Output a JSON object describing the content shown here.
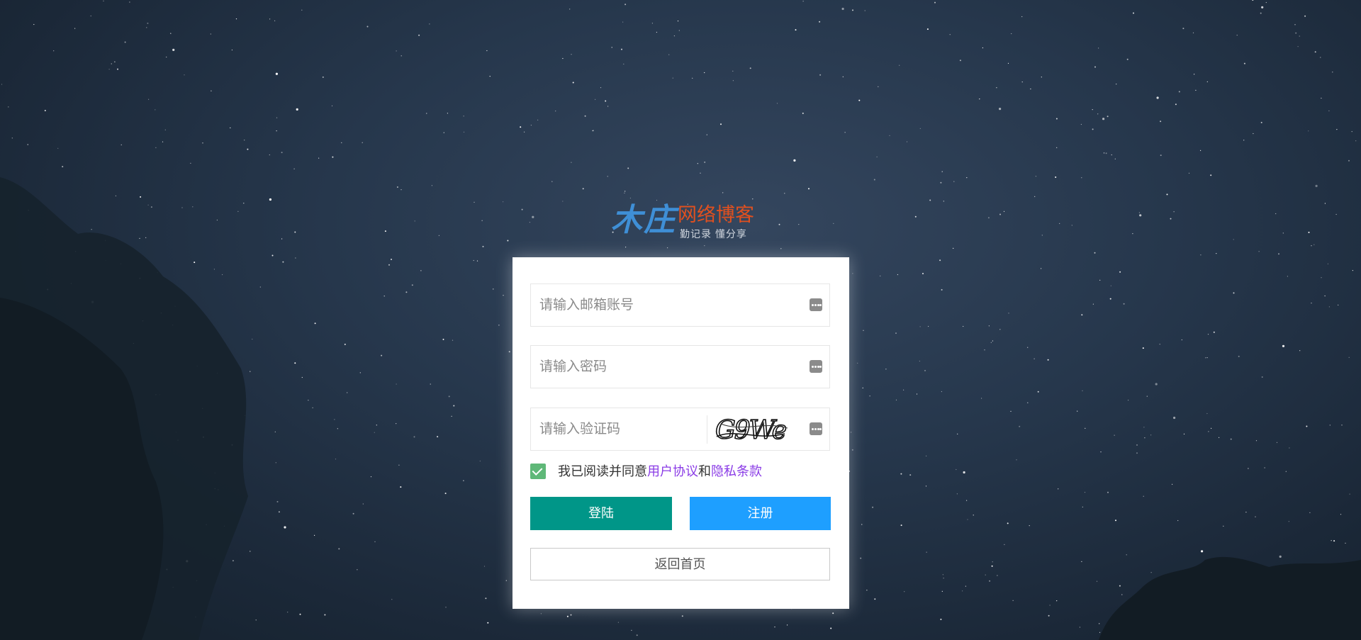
{
  "logo": {
    "brand_calligraphy": "木庄",
    "title": "网络博客",
    "subtitle": "勤记录 懂分享"
  },
  "form": {
    "email_placeholder": "请输入邮箱账号",
    "password_placeholder": "请输入密码",
    "captcha_placeholder": "请输入验证码",
    "captcha_text": "G9We",
    "agree_prefix": "我已阅读并同意",
    "user_agreement": "用户协议",
    "and": "和",
    "privacy_policy": "隐私条款",
    "agree_checked": true
  },
  "buttons": {
    "login": "登陆",
    "register": "注册",
    "home": "返回首页"
  },
  "colors": {
    "login": "#009688",
    "register": "#1e9fff",
    "checkbox": "#5fb878",
    "link": "#8a3be6",
    "logo_title": "#e0501f"
  }
}
